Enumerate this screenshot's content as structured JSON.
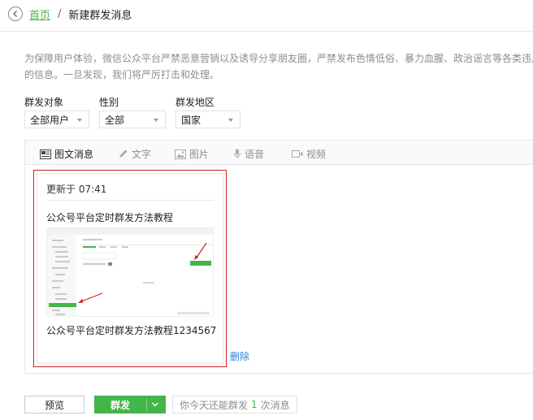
{
  "breadcrumb": {
    "home": "首页",
    "separator": "/",
    "current": "新建群发消息"
  },
  "notice": {
    "line1": "为保障用户体验，微信公众平台严禁恶意营销以及诱导分享朋友圈，严禁发布色情低俗、暴力血腥、政治谣言等各类违反",
    "line2": "的信息。一旦发现，我们将严厉打击和处理。"
  },
  "filters": {
    "target": {
      "label": "群发对象",
      "value": "全部用户"
    },
    "gender": {
      "label": "性别",
      "value": "全部"
    },
    "region": {
      "label": "群发地区",
      "value": "国家"
    }
  },
  "tabs": [
    {
      "label": "图文消息",
      "icon": "news-icon",
      "active": true
    },
    {
      "label": "文字",
      "icon": "pen-icon",
      "active": false
    },
    {
      "label": "图片",
      "icon": "image-icon",
      "active": false
    },
    {
      "label": "语音",
      "icon": "microphone-icon",
      "active": false
    },
    {
      "label": "视频",
      "icon": "video-icon",
      "active": false
    }
  ],
  "article": {
    "updated": "更新于 07:41",
    "title": "公众号平台定时群发方法教程",
    "summary": "公众号平台定时群发方法教程1234567"
  },
  "delete_label": "删除",
  "actions": {
    "preview": "预览",
    "send": "群发",
    "quota_prefix": "你今天还能群发",
    "quota_count": "1",
    "quota_suffix": "次消息"
  },
  "colors": {
    "brand_green": "#44b549",
    "link_blue": "#2f7bd8",
    "highlight_red": "#cc2222"
  }
}
